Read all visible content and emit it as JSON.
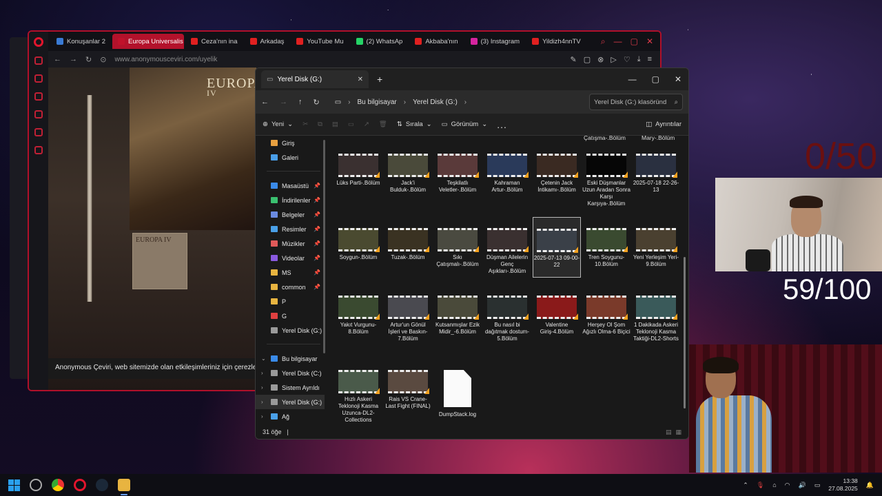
{
  "browser": {
    "tabs": [
      {
        "label": "Konuşanlar 2",
        "color": "#3a7bd5"
      },
      {
        "label": "Europa Universalis IV",
        "color": "#c0122b",
        "active": true
      },
      {
        "label": "Ceza'nın ina",
        "color": "#e02020"
      },
      {
        "label": "Arkadaş",
        "color": "#e02020"
      },
      {
        "label": "YouTube Mu",
        "color": "#e02020"
      },
      {
        "label": "(2) WhatsAp",
        "color": "#25d366"
      },
      {
        "label": "Akbaba'nın",
        "color": "#e02020"
      },
      {
        "label": "(3) Instagram",
        "color": "#d6249f"
      },
      {
        "label": "Yildizh4nnTV",
        "color": "#e02020"
      }
    ],
    "url": "www.anonymousceviri.com/uyelik",
    "game_title": "EUROPA UNIVERSALIS",
    "game_sub": "IV",
    "cookie_text": "Anonymous Çeviri, web sitemizde olan etkileşimleriniz için çerezleri ku"
  },
  "explorer": {
    "tab_title": "Yerel Disk (G:)",
    "crumbs": [
      "Bu bilgisayar",
      "Yerel Disk (G:)"
    ],
    "search_placeholder": "Yerel Disk (G:) klasöründ",
    "commands": {
      "new": "Yeni",
      "sort": "Sırala",
      "view": "Görünüm",
      "more": "...",
      "details": "Ayrıntılar"
    },
    "nav": [
      {
        "label": "Giriş",
        "color": "#e8a040"
      },
      {
        "label": "Galeri",
        "color": "#4a9ee8"
      }
    ],
    "quick": [
      {
        "label": "Masaüstü",
        "color": "#3a8ae8",
        "pinned": true
      },
      {
        "label": "İndirilenler",
        "color": "#3ac070",
        "pinned": true
      },
      {
        "label": "Belgeler",
        "color": "#6a8ae0",
        "pinned": true
      },
      {
        "label": "Resimler",
        "color": "#4aa0e8",
        "pinned": true
      },
      {
        "label": "Müzikler",
        "color": "#e05a5a",
        "pinned": true
      },
      {
        "label": "Videolar",
        "color": "#8a5ae0",
        "pinned": true
      },
      {
        "label": "MS",
        "color": "#e8b440",
        "pinned": true
      },
      {
        "label": "common",
        "color": "#e8b440",
        "pinned": true
      },
      {
        "label": "P",
        "color": "#e8b440",
        "pinned": false
      },
      {
        "label": "G",
        "color": "#e04040",
        "pinned": false
      },
      {
        "label": "Yerel Disk (G:)",
        "color": "#9a9a9a",
        "pinned": false
      }
    ],
    "tree": [
      {
        "label": "Bu bilgisayar",
        "color": "#3a8ae8",
        "chev": "⌄"
      },
      {
        "label": "Yerel Disk (C:)",
        "color": "#9a9a9a",
        "chev": "›"
      },
      {
        "label": "Sistem Ayrıldı",
        "color": "#9a9a9a",
        "chev": "›"
      },
      {
        "label": "Yerel Disk (G:)",
        "color": "#9a9a9a",
        "chev": "›",
        "selected": true
      },
      {
        "label": "Ağ",
        "color": "#4aa0e8",
        "chev": "›"
      }
    ],
    "top_cut": [
      "Çatışma-.Bölüm",
      "Mary-.Bölüm"
    ],
    "files": [
      {
        "name": "Lüks Parti-.Bölüm",
        "thumb": "#3a3030"
      },
      {
        "name": "Jack'i Bulduk-.Bölüm",
        "thumb": "#4a4a3a"
      },
      {
        "name": "Teşkilatlı Veletler-.Bölüm",
        "thumb": "#5a3a3a"
      },
      {
        "name": "Kahraman Artur-.Bölüm",
        "thumb": "#2a3a5a"
      },
      {
        "name": "Çetenin Jack İntikamı-.Bölüm",
        "thumb": "#3a2a22"
      },
      {
        "name": "Eski Düşmanlar Uzun Aradan Sonra Karşı Karşıya-.Bölüm",
        "thumb": "#060606"
      },
      {
        "name": "2025-07-18 22-26-13",
        "thumb": "#2a3040"
      },
      {
        "name": "Soygun-.Bölüm",
        "thumb": "#4a4a30"
      },
      {
        "name": "Tuzak-.Bölüm",
        "thumb": "#3a3222"
      },
      {
        "name": "Sıkı Çatışmalı-.Bölüm",
        "thumb": "#4a4a40"
      },
      {
        "name": "Düşman Ailelerin Genç Aşıkları-.Bölüm",
        "thumb": "#3a3030"
      },
      {
        "name": "2025-07-13 09-00-22",
        "thumb": "#3a4048",
        "selected": true
      },
      {
        "name": "Tren Soygunu-10.Bölüm",
        "thumb": "#3a4a30"
      },
      {
        "name": "Yeni Yerleşim Yeri-9.Bölüm",
        "thumb": "#4a4030"
      },
      {
        "name": "Yakıt Vurgunu-8.Bölüm",
        "thumb": "#3a4a30"
      },
      {
        "name": "Artur'un Gönül İşleri ve Baskın-7.Bölüm",
        "thumb": "#4a4a50"
      },
      {
        "name": "Kutsanmışlar Ezik Midir_-6.Bölüm",
        "thumb": "#4a4a3a"
      },
      {
        "name": "Bu nasıl bi dağıtmak dostum-5.Bölüm",
        "thumb": "#2a3030"
      },
      {
        "name": "Valentine Giriş-4.Bölüm",
        "thumb": "#8a1a1a"
      },
      {
        "name": "Herşey Ol Şom Ağızlı Olma-6 Biçici",
        "thumb": "#7a3a2a"
      },
      {
        "name": "1 Dakikada Askeri Teklonoji Kasma Taktiği-DL2-Shorts",
        "thumb": "#3a5a5a"
      },
      {
        "name": "Hızlı Askeri Teklonoji Kasma Uzunca-DL2-Collections",
        "thumb": "#4a5a4a"
      },
      {
        "name": "Rais VS Crane-Last Fight (FINAL)",
        "thumb": "#5a4a40"
      },
      {
        "name": "DumpStack.log",
        "doc": true
      }
    ],
    "status": "31 öğe",
    "status_sep": "|"
  },
  "overlay": {
    "counter_red": "0/50",
    "counter_white": "59/100"
  },
  "taskbar": {
    "time": "13:38",
    "date": "27.08.2025"
  }
}
